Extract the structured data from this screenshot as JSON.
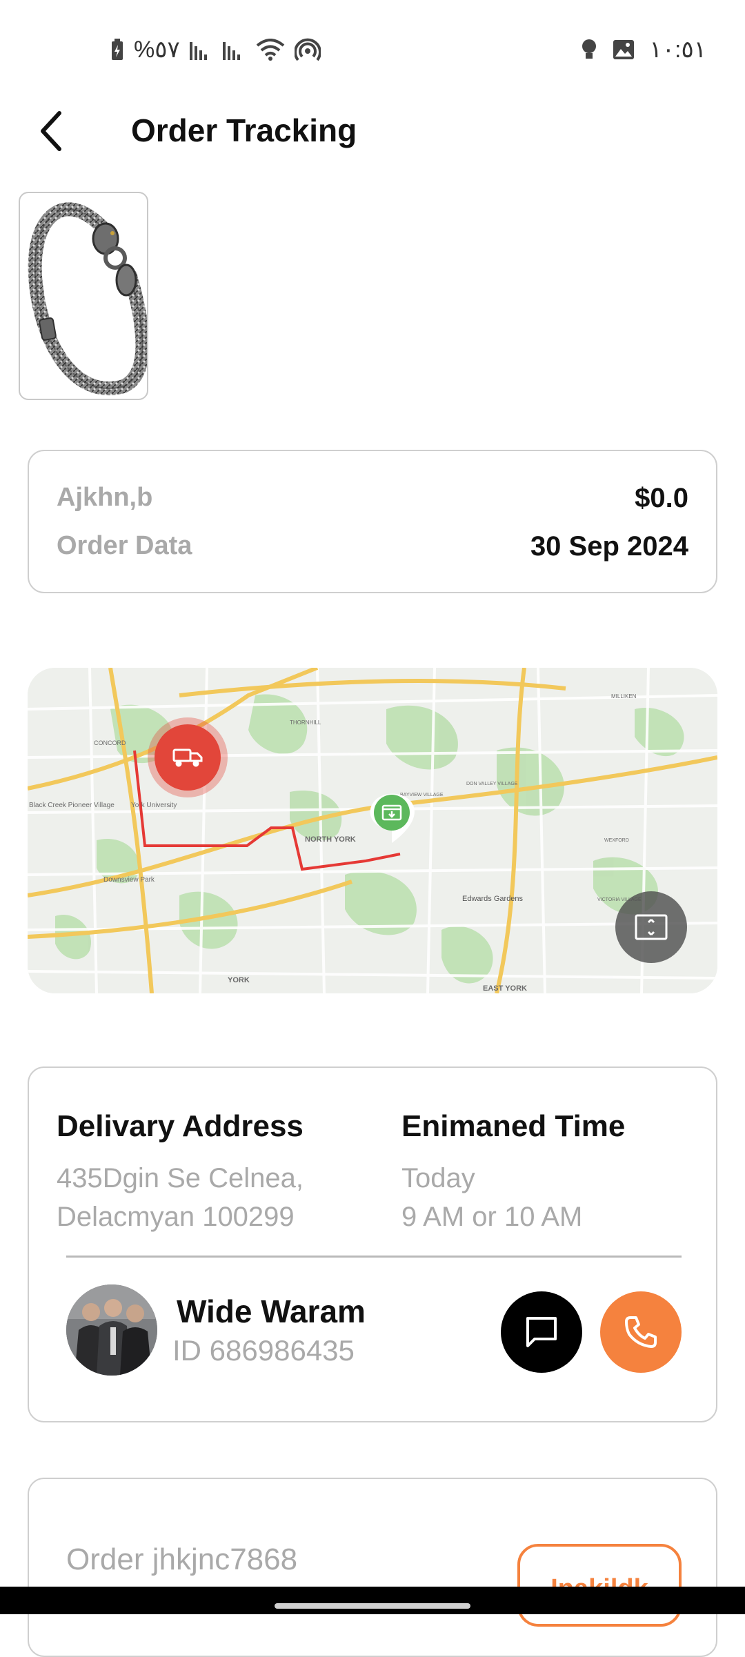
{
  "status_bar": {
    "battery_text": "%٥٧",
    "time": "١٠:٥١",
    "icons": [
      "battery-icon",
      "signal-icon",
      "signal-icon",
      "wifi-icon",
      "hotspot-icon",
      "bulb-icon",
      "image-icon"
    ]
  },
  "header": {
    "title": "Order Tracking",
    "back_icon": "back-arrow-icon"
  },
  "product": {
    "image": "bracelet-image"
  },
  "summary": {
    "name": "Ajkhn,b",
    "price": "$0.0",
    "date_label": "Order Data",
    "date_value": "30 Sep 2024"
  },
  "map": {
    "labels": [
      "NORTH YORK",
      "Edwards Gardens",
      "York University",
      "Downsview Park",
      "YORK",
      "EAST YORK",
      "Black Creek Pioneer Village",
      "CONCORD",
      "THORNHILL",
      "MILLIKEN",
      "BAYVIEW VILLAGE",
      "DON VALLEY VILLAGE",
      "WEXFORD",
      "VICTORIA VILLAGE"
    ],
    "colors": {
      "route": "#e53935",
      "origin_pin": "#e2463a",
      "destination_pin": "#5cb85c",
      "highway": "#f2c85b"
    },
    "origin_icon": "truck-icon",
    "destination_icon": "package-icon",
    "fullscreen_icon": "fullscreen-icon"
  },
  "delivery": {
    "address_title": "Delivary Address",
    "address_line1": "435Dgin Se Celnea,",
    "address_line2": "Delacmyan 100299",
    "time_title": "Enimaned Time",
    "time_line1": "Today",
    "time_line2": "9 AM or 10 AM",
    "courier_name": "Wide Waram",
    "courier_id": "ID 686986435",
    "chat_icon": "chat-icon",
    "call_icon": "phone-icon",
    "colors": {
      "call": "#f5823e",
      "chat": "#000000"
    }
  },
  "order": {
    "order_id": "Order jhkjnc7868",
    "action_label": "Inakildk"
  }
}
